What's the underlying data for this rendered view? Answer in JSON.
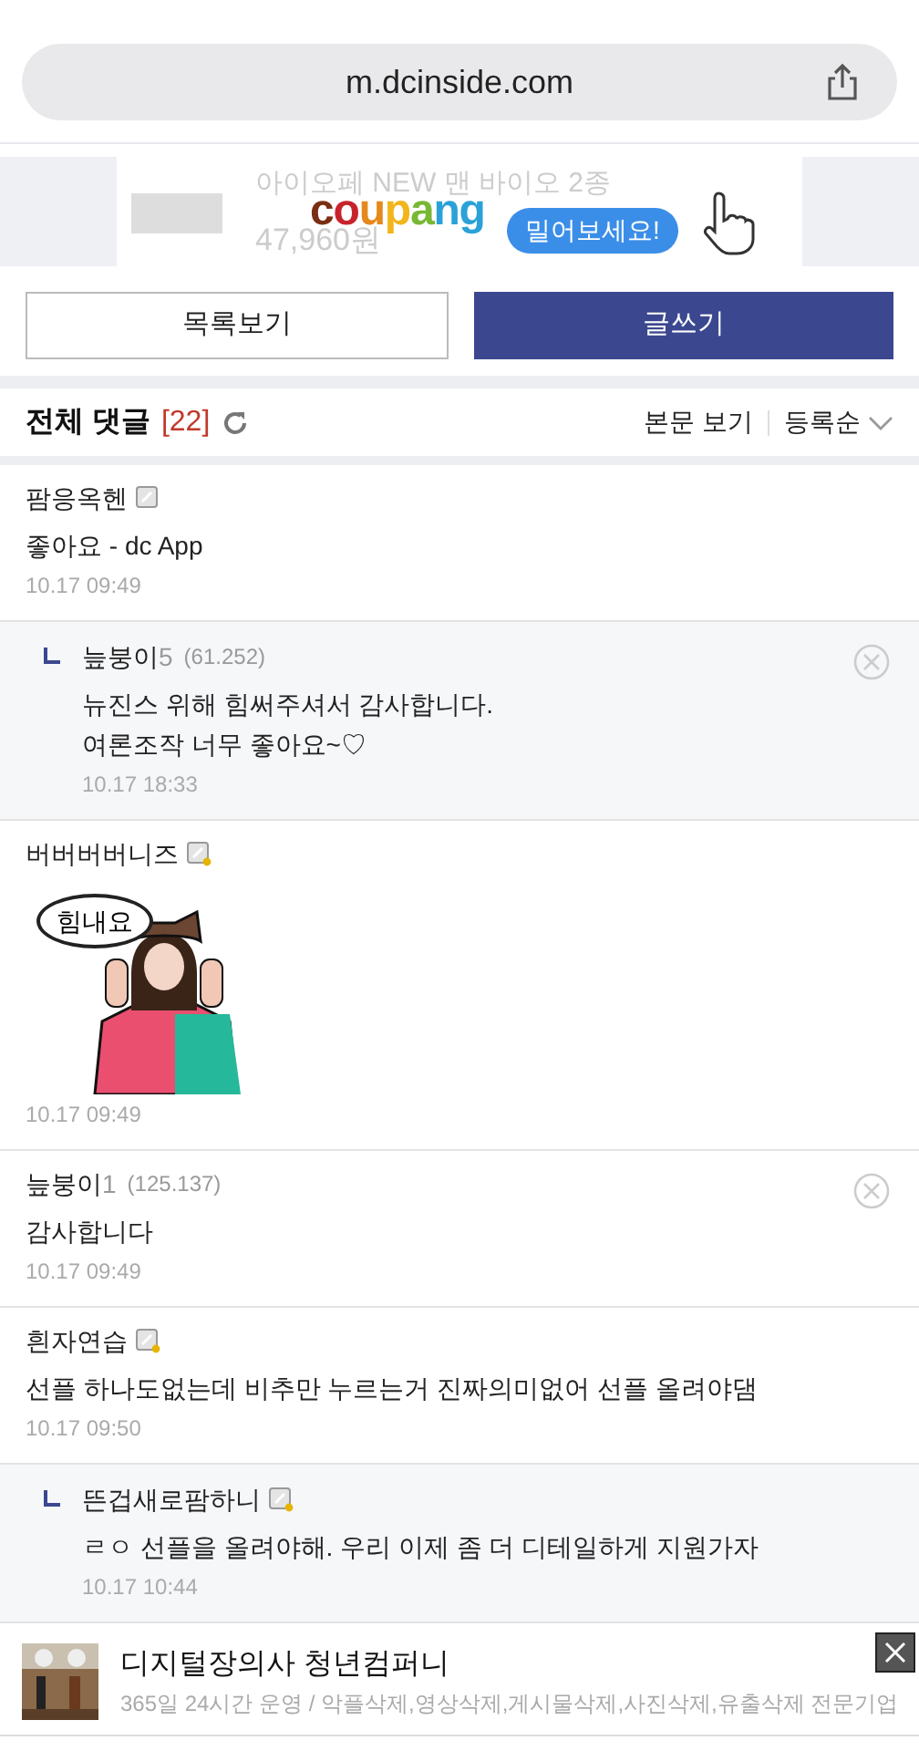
{
  "address_bar": {
    "url": "m.dcinside.com"
  },
  "top_ad": {
    "title": "아이오페 NEW 맨 바이오 2종",
    "price": "47,960원",
    "brand": "coupang",
    "callout": "밀어보세요!"
  },
  "buttons": [
    {
      "label": "목록보기",
      "primary": false
    },
    {
      "label": "글쓰기",
      "primary": true
    }
  ],
  "comments_header": {
    "title": "전체 댓글",
    "count": "[22]",
    "view_post": "본문 보기",
    "sort": "등록순"
  },
  "comments": [
    {
      "kind": "comment",
      "name": "팜응옥헨",
      "badge": true,
      "badge_dot": false,
      "text": "좋아요 - dc App",
      "time": "10.17 09:49",
      "deletable": false
    },
    {
      "kind": "reply",
      "name": "늪붕이",
      "suffix": "5",
      "ip": "(61.252)",
      "text": "뉴진스 위해 힘써주셔서 감사합니다.\n여론조작 너무 좋아요~♡",
      "time": "10.17 18:33",
      "deletable": true
    },
    {
      "kind": "sticker",
      "name": "버버버버니즈",
      "badge": true,
      "badge_dot": true,
      "sticker_text": "힘내요",
      "time": "10.17 09:49",
      "deletable": false
    },
    {
      "kind": "comment",
      "name": "늪붕이",
      "suffix": "1",
      "ip": "(125.137)",
      "text": "감사합니다",
      "time": "10.17 09:49",
      "deletable": true
    },
    {
      "kind": "comment",
      "name": "흰자연습",
      "badge": true,
      "badge_dot": true,
      "text": "선플 하나도없는데 비추만 누르는거 진짜의미없어 선플 올려야댐",
      "time": "10.17 09:50",
      "deletable": false
    },
    {
      "kind": "reply",
      "name": "뜬겁새로팜하니",
      "badge": true,
      "badge_dot": true,
      "text": "ㄹㅇ 선플을 올려야해. 우리 이제 좀 더 디테일하게 지원가자",
      "time": "10.17 10:44",
      "deletable": false
    }
  ],
  "bottom_ad": {
    "title": "디지털장의사 청년컴퍼니",
    "subtitle": "365일 24시간 운영 / 악플삭제,영상삭제,게시물삭제,사진삭제,유출삭제 전문기업"
  }
}
